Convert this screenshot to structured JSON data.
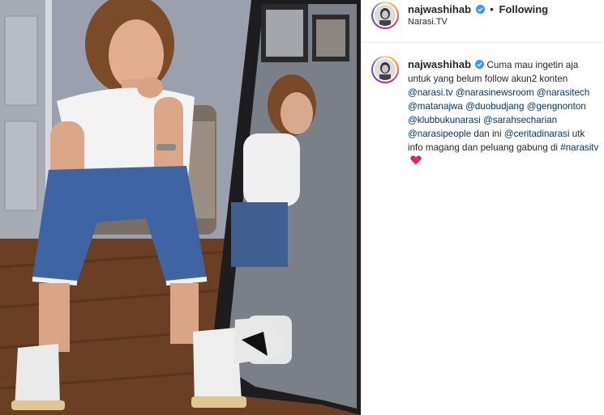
{
  "header": {
    "username": "najwashihab",
    "separator": "•",
    "follow_status": "Following",
    "location": "Narasi.TV"
  },
  "caption": {
    "username": "najwashihab",
    "text_1": "Cuma mau ingetin aja untuk yang belum follow akun2 konten",
    "mentions_1": [
      "@narasi.tv",
      "@narasinewsroom",
      "@narasitech",
      "@matanajwa",
      "@duobudjang",
      "@gengnonton",
      "@klubbukunarasi",
      "@sarahsecharian",
      "@narasipeople"
    ],
    "text_2": "dan ini",
    "mention_2": "@ceritadinarasi",
    "text_3": "utk info magang dan peluang gabung di",
    "hashtag": "#narasitv"
  },
  "icons": {
    "verified": "verified-badge-icon",
    "heart": "red-heart-emoji-icon"
  },
  "colors": {
    "link": "#00376b",
    "verified": "#3897f0",
    "heart": "#e0245e",
    "text": "#262626"
  }
}
